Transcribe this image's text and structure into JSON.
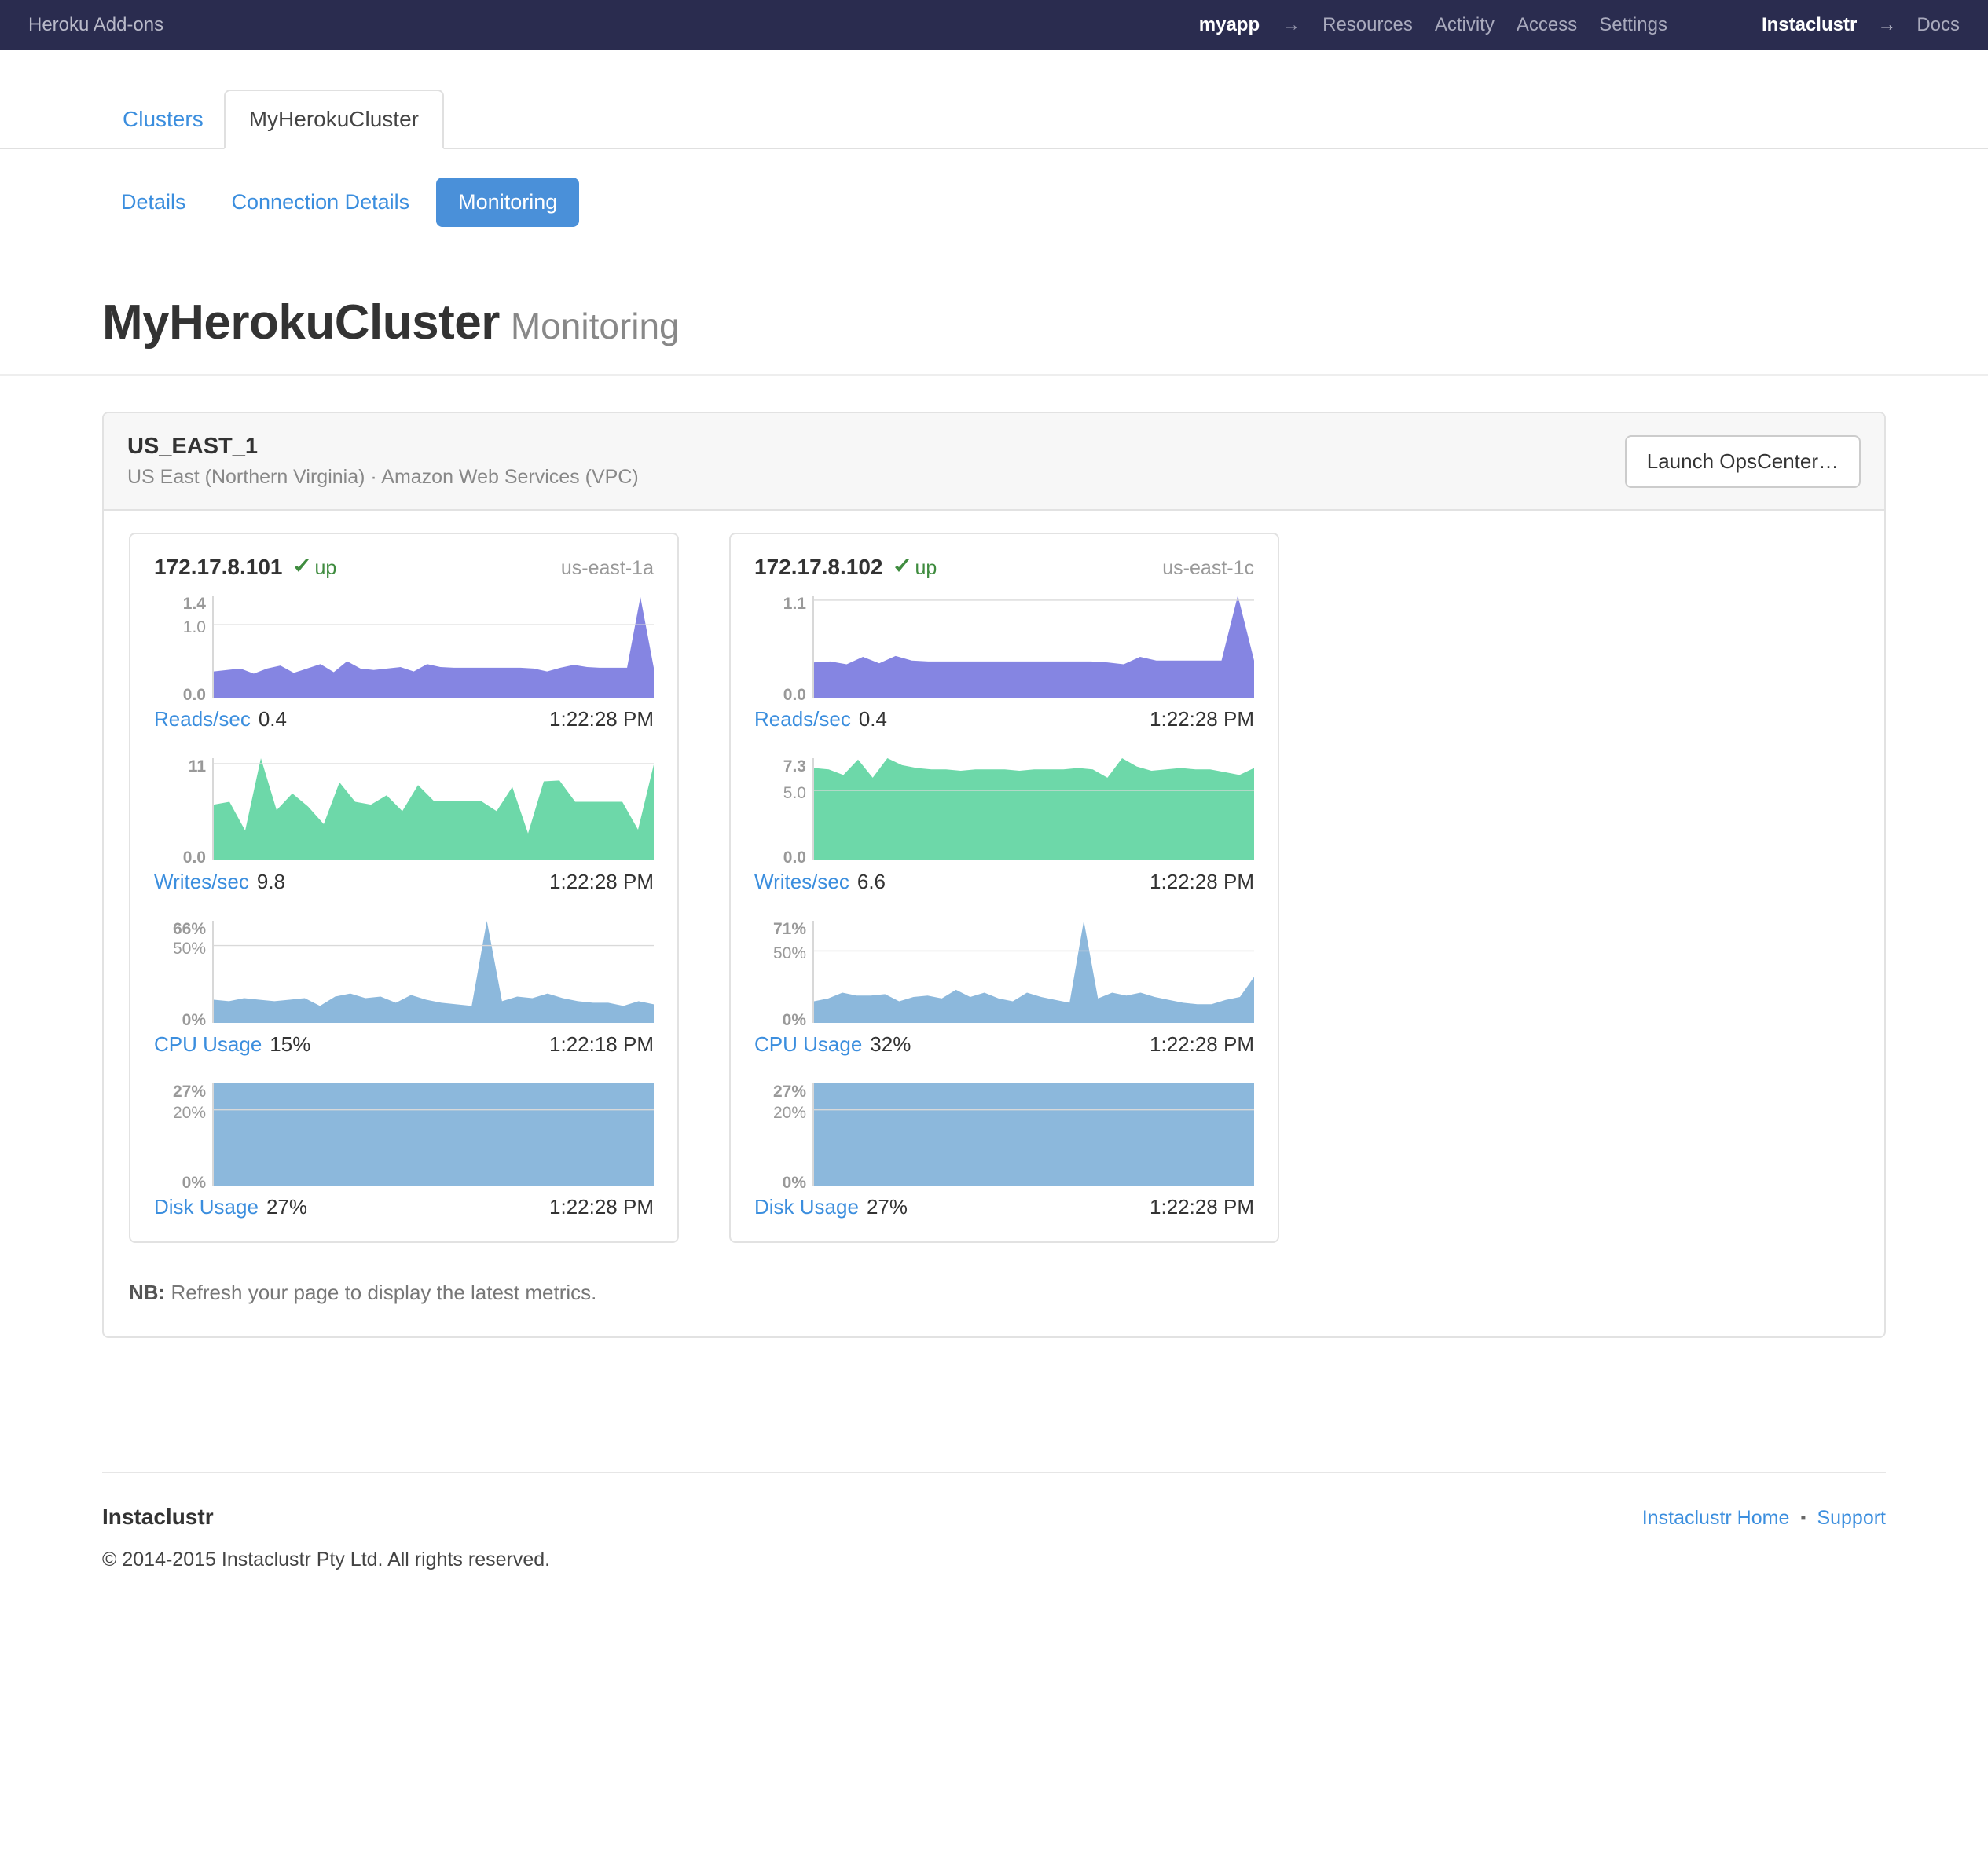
{
  "topbar": {
    "brand": "Heroku Add-ons",
    "app_name": "myapp",
    "arrow": "→",
    "links": [
      "Resources",
      "Activity",
      "Access",
      "Settings"
    ],
    "vendor": "Instaclustr",
    "vendor_arrow": "→",
    "vendor_link": "Docs",
    "bg_color": "#2a2c4f"
  },
  "tabs": [
    {
      "label": "Clusters",
      "active": false
    },
    {
      "label": "MyHerokuCluster",
      "active": true
    }
  ],
  "subtabs": [
    {
      "label": "Details",
      "active": false
    },
    {
      "label": "Connection Details",
      "active": false
    },
    {
      "label": "Monitoring",
      "active": true
    }
  ],
  "heading": {
    "title": "MyHerokuCluster",
    "subtitle": "Monitoring"
  },
  "region": {
    "name": "US_EAST_1",
    "description": "US East (Northern Virginia) · Amazon Web Services (VPC)",
    "launch_button": "Launch OpsCenter…"
  },
  "note": {
    "label": "NB:",
    "text": " Refresh your page to display the latest metrics."
  },
  "footer": {
    "brand": "Instaclustr",
    "copyright": "© 2014-2015 Instaclustr Pty Ltd. All rights reserved.",
    "links": [
      "Instaclustr Home",
      "Support"
    ],
    "separator": "▪"
  },
  "nodes": [
    {
      "ip": "172.17.8.101",
      "status": "up",
      "status_icon": "check-icon",
      "status_color": "#3f8c3f",
      "availability_zone": "us-east-1a",
      "metrics": [
        {
          "name": "Reads/sec",
          "value": "0.4",
          "time": "1:22:28 PM",
          "chart": "reads_101"
        },
        {
          "name": "Writes/sec",
          "value": "9.8",
          "time": "1:22:28 PM",
          "chart": "writes_101"
        },
        {
          "name": "CPU Usage",
          "value": "15%",
          "time": "1:22:18 PM",
          "chart": "cpu_101"
        },
        {
          "name": "Disk Usage",
          "value": "27%",
          "time": "1:22:28 PM",
          "chart": "disk_101"
        }
      ]
    },
    {
      "ip": "172.17.8.102",
      "status": "up",
      "status_icon": "check-icon",
      "status_color": "#3f8c3f",
      "availability_zone": "us-east-1c",
      "metrics": [
        {
          "name": "Reads/sec",
          "value": "0.4",
          "time": "1:22:28 PM",
          "chart": "reads_102"
        },
        {
          "name": "Writes/sec",
          "value": "6.6",
          "time": "1:22:28 PM",
          "chart": "writes_102"
        },
        {
          "name": "CPU Usage",
          "value": "32%",
          "time": "1:22:28 PM",
          "chart": "cpu_102"
        },
        {
          "name": "Disk Usage",
          "value": "27%",
          "time": "1:22:28 PM",
          "chart": "disk_102"
        }
      ]
    }
  ],
  "chart_data": {
    "reads_101": {
      "type": "area",
      "title": "Reads/sec",
      "ylabel": "Reads/sec",
      "xlabel": "",
      "ylim": [
        0.0,
        1.4
      ],
      "ticks": [
        {
          "label": "1.4",
          "value": 1.4,
          "bold": true
        },
        {
          "label": "1.0",
          "value": 1.0,
          "bold": false
        },
        {
          "label": "0.0",
          "value": 0.0,
          "bold": true
        }
      ],
      "gridlines": [
        1.0
      ],
      "color": "#8585e2",
      "values": [
        0.36,
        0.38,
        0.4,
        0.33,
        0.4,
        0.44,
        0.34,
        0.4,
        0.46,
        0.35,
        0.5,
        0.4,
        0.38,
        0.4,
        0.42,
        0.36,
        0.46,
        0.42,
        0.41,
        0.41,
        0.41,
        0.41,
        0.41,
        0.41,
        0.4,
        0.36,
        0.41,
        0.45,
        0.42,
        0.41,
        0.41,
        0.41,
        1.38,
        0.41
      ]
    },
    "writes_101": {
      "type": "area",
      "title": "Writes/sec",
      "ylabel": "Writes/sec",
      "xlabel": "",
      "ylim": [
        0.0,
        11.0
      ],
      "ticks": [
        {
          "label": "11",
          "value": 11.0,
          "bold": true
        },
        {
          "label": "0.0",
          "value": 0.0,
          "bold": true
        }
      ],
      "gridlines": [
        10.4
      ],
      "color": "#6dd8a9",
      "values": [
        6.0,
        6.3,
        3.2,
        11.0,
        5.4,
        7.2,
        5.8,
        3.9,
        8.4,
        6.3,
        6.0,
        7.0,
        5.3,
        8.1,
        6.4,
        6.4,
        6.4,
        6.4,
        5.3,
        7.9,
        2.9,
        8.5,
        8.6,
        6.3,
        6.3,
        6.3,
        6.3,
        3.3,
        10.3
      ]
    },
    "cpu_101": {
      "type": "area",
      "title": "CPU Usage",
      "ylabel": "CPU %",
      "xlabel": "",
      "ylim": [
        0,
        66
      ],
      "ticks": [
        {
          "label": "66%",
          "value": 66,
          "bold": true
        },
        {
          "label": "50%",
          "value": 50,
          "bold": false
        },
        {
          "label": "0%",
          "value": 0,
          "bold": true
        }
      ],
      "gridlines": [
        50
      ],
      "color": "#8cb8dc",
      "values": [
        15,
        14,
        16,
        15,
        14,
        15,
        16,
        11,
        17,
        19,
        16,
        17,
        13,
        18,
        15,
        13,
        12,
        11,
        66,
        14,
        17,
        16,
        19,
        16,
        14,
        13,
        13,
        11,
        14,
        12
      ]
    },
    "disk_101": {
      "type": "area",
      "title": "Disk Usage",
      "ylabel": "Disk %",
      "xlabel": "",
      "ylim": [
        0,
        27
      ],
      "ticks": [
        {
          "label": "27%",
          "value": 27,
          "bold": true
        },
        {
          "label": "20%",
          "value": 20,
          "bold": false
        },
        {
          "label": "0%",
          "value": 0,
          "bold": true
        }
      ],
      "gridlines": [
        20
      ],
      "color": "#8cb8dc",
      "values": [
        27,
        27,
        27,
        27,
        27,
        27,
        27,
        27,
        27,
        27,
        27,
        27,
        27,
        27,
        27,
        27,
        27,
        27,
        27,
        27,
        27,
        27,
        27,
        27,
        27,
        27,
        27,
        27,
        27,
        27
      ]
    },
    "reads_102": {
      "type": "area",
      "title": "Reads/sec",
      "ylabel": "Reads/sec",
      "xlabel": "",
      "ylim": [
        0.0,
        1.1
      ],
      "ticks": [
        {
          "label": "1.1",
          "value": 1.1,
          "bold": true
        },
        {
          "label": "0.0",
          "value": 0.0,
          "bold": true
        }
      ],
      "gridlines": [
        1.05
      ],
      "color": "#8585e2",
      "values": [
        0.38,
        0.39,
        0.36,
        0.44,
        0.37,
        0.45,
        0.4,
        0.39,
        0.39,
        0.39,
        0.39,
        0.39,
        0.39,
        0.39,
        0.39,
        0.39,
        0.39,
        0.39,
        0.38,
        0.36,
        0.44,
        0.4,
        0.4,
        0.4,
        0.4,
        0.4,
        1.1,
        0.4
      ]
    },
    "writes_102": {
      "type": "area",
      "title": "Writes/sec",
      "ylabel": "Writes/sec",
      "xlabel": "",
      "ylim": [
        0.0,
        7.3
      ],
      "ticks": [
        {
          "label": "7.3",
          "value": 7.3,
          "bold": true
        },
        {
          "label": "5.0",
          "value": 5.0,
          "bold": false
        },
        {
          "label": "0.0",
          "value": 0.0,
          "bold": true
        }
      ],
      "gridlines": [
        5.0
      ],
      "color": "#6dd8a9",
      "values": [
        6.6,
        6.5,
        6.1,
        7.2,
        5.9,
        7.3,
        6.8,
        6.6,
        6.5,
        6.5,
        6.4,
        6.5,
        6.5,
        6.5,
        6.4,
        6.5,
        6.5,
        6.5,
        6.6,
        6.5,
        5.9,
        7.3,
        6.7,
        6.4,
        6.5,
        6.6,
        6.5,
        6.5,
        6.3,
        6.1,
        6.6
      ]
    },
    "cpu_102": {
      "type": "area",
      "title": "CPU Usage",
      "ylabel": "CPU %",
      "xlabel": "",
      "ylim": [
        0,
        71
      ],
      "ticks": [
        {
          "label": "71%",
          "value": 71,
          "bold": true
        },
        {
          "label": "50%",
          "value": 50,
          "bold": false
        },
        {
          "label": "0%",
          "value": 0,
          "bold": true
        }
      ],
      "gridlines": [
        50
      ],
      "color": "#8cb8dc",
      "values": [
        15,
        17,
        21,
        19,
        19,
        20,
        15,
        18,
        19,
        17,
        23,
        18,
        21,
        17,
        15,
        21,
        18,
        16,
        14,
        71,
        17,
        21,
        19,
        21,
        18,
        16,
        14,
        13,
        13,
        16,
        18,
        32
      ]
    },
    "disk_102": {
      "type": "area",
      "title": "Disk Usage",
      "ylabel": "Disk %",
      "xlabel": "",
      "ylim": [
        0,
        27
      ],
      "ticks": [
        {
          "label": "27%",
          "value": 27,
          "bold": true
        },
        {
          "label": "20%",
          "value": 20,
          "bold": false
        },
        {
          "label": "0%",
          "value": 0,
          "bold": true
        }
      ],
      "gridlines": [
        20
      ],
      "color": "#8cb8dc",
      "values": [
        27,
        27,
        27,
        27,
        27,
        27,
        27,
        27,
        27,
        27,
        27,
        27,
        27,
        27,
        27,
        27,
        27,
        27,
        27,
        27,
        27,
        27,
        27,
        27,
        27,
        27,
        27,
        27,
        27,
        27
      ]
    }
  }
}
